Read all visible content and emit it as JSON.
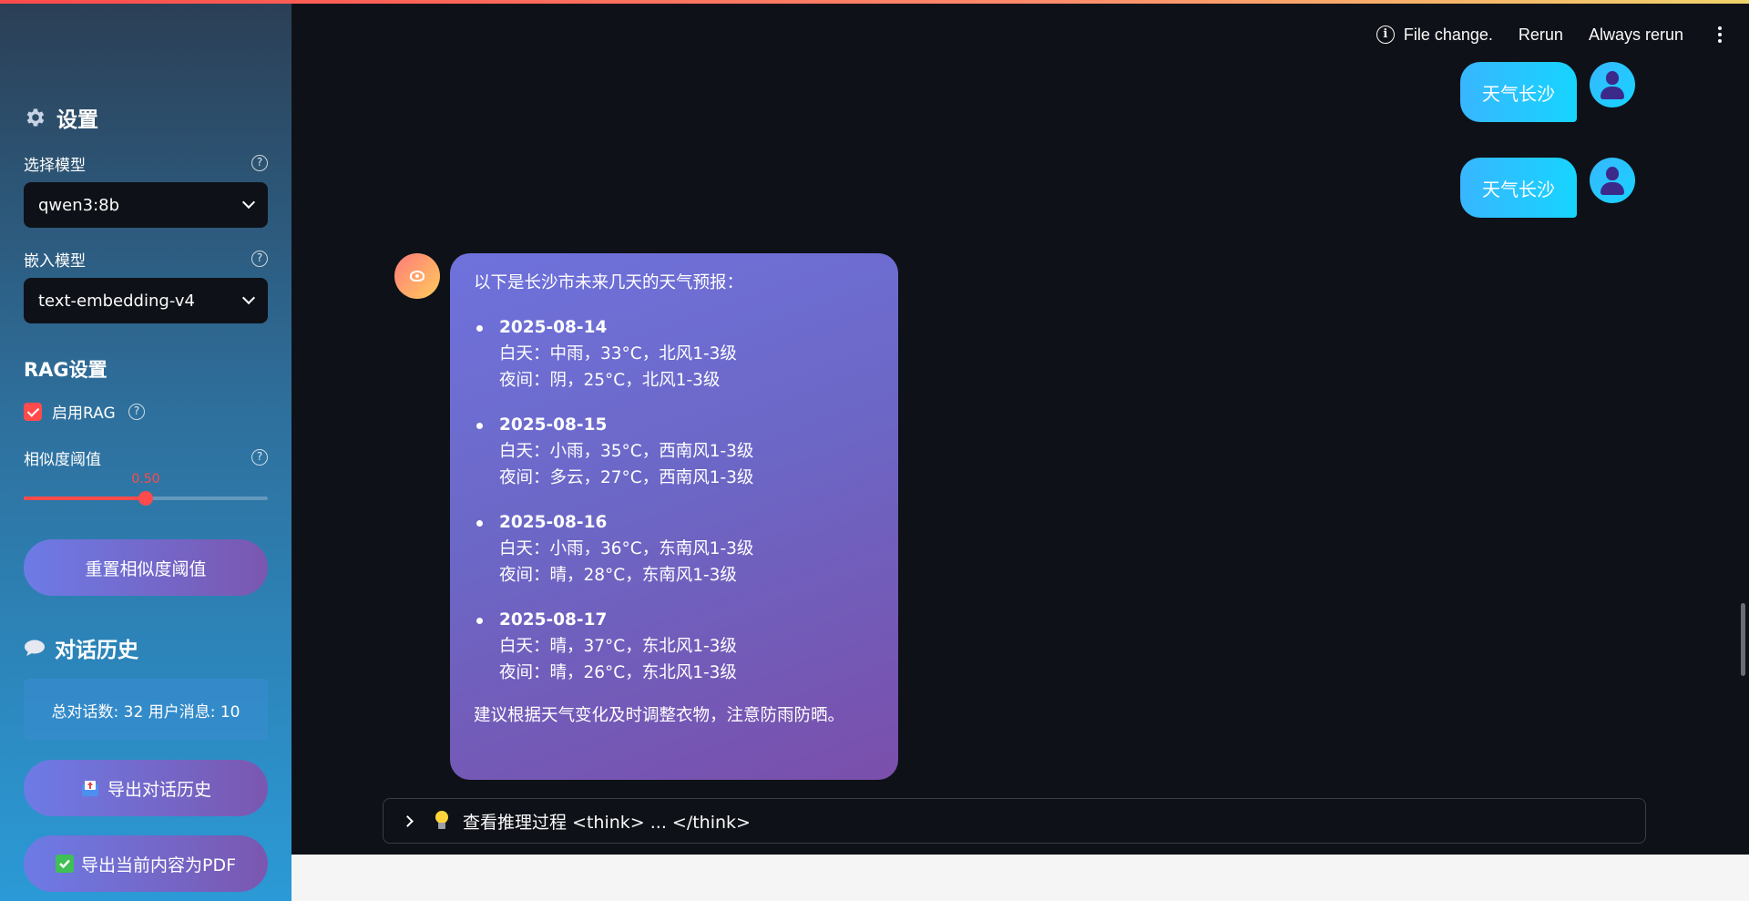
{
  "sidebar": {
    "settings_title": "设置",
    "model_label": "选择模型",
    "model_value": "qwen3:8b",
    "embed_label": "嵌入模型",
    "embed_value": "text-embedding-v4",
    "rag_title": "RAG设置",
    "rag_enable_label": "启用RAG",
    "rag_enabled": true,
    "threshold_label": "相似度阈值",
    "threshold_value": "0.50",
    "threshold_fraction": 0.5,
    "reset_button": "重置相似度阈值",
    "history_title": "对话历史",
    "stats": "总对话数: 32 用户消息: 10",
    "export_history_button": "导出对话历史",
    "export_pdf_button": "导出当前内容为PDF"
  },
  "header": {
    "status": "File change.",
    "rerun": "Rerun",
    "always_rerun": "Always rerun"
  },
  "chat": {
    "user_messages": [
      "天气长沙",
      "天气长沙"
    ],
    "bot_intro": "以下是长沙市未来几天的天气预报：",
    "forecast": [
      {
        "date": "2025-08-14",
        "day": "白天：中雨，33°C，北风1-3级",
        "night": "夜间：阴，25°C，北风1-3级"
      },
      {
        "date": "2025-08-15",
        "day": "白天：小雨，35°C，西南风1-3级",
        "night": "夜间：多云，27°C，西南风1-3级"
      },
      {
        "date": "2025-08-16",
        "day": "白天：小雨，36°C，东南风1-3级",
        "night": "夜间：晴，28°C，东南风1-3级"
      },
      {
        "date": "2025-08-17",
        "day": "白天：晴，37°C，东北风1-3级",
        "night": "夜间：晴，26°C，东北风1-3级"
      }
    ],
    "bot_outro": "建议根据天气变化及时调整衣物，注意防雨防晒。",
    "expander_label": "查看推理过程 <think> ... </think>"
  },
  "icons": {
    "settings": "gear-icon",
    "history": "speech-bubble-icon",
    "export_history": "outbox-icon",
    "export_pdf": "check-mark-icon",
    "reasoning": "light-bulb-icon"
  },
  "colors": {
    "accent": "#ff4b4b",
    "user_bubble": "#16d4ff",
    "bot_bubble": "#6f72dc",
    "app_bg": "#0e1117"
  }
}
